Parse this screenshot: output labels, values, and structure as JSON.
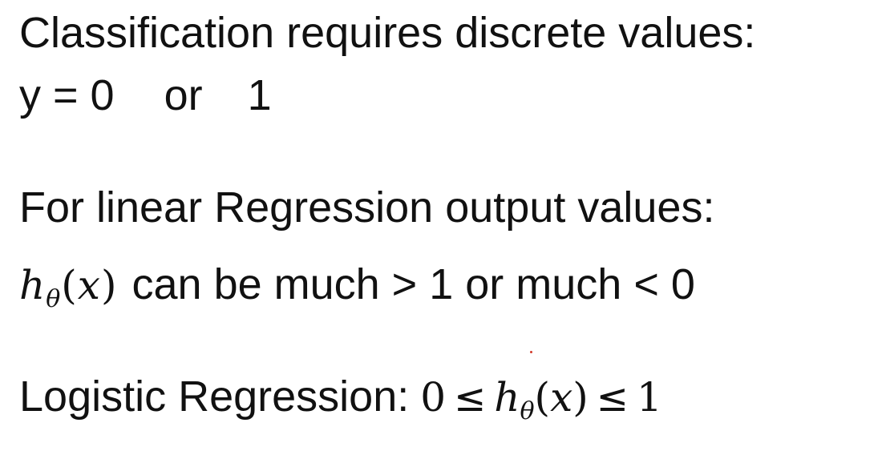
{
  "slide": {
    "line1": "Classification requires discrete values:",
    "line2": {
      "y_eq": "y = 0",
      "or": "or",
      "one": "1"
    },
    "line3": "For linear Regression output values:",
    "line4": {
      "h": "h",
      "theta": "θ",
      "arg_open": "(",
      "x": "x",
      "arg_close": ")",
      "text": "can be much > 1 or much < 0"
    },
    "line5": {
      "label": "Logistic Regression:",
      "zero": "0",
      "leq1": "≤",
      "h": "h",
      "theta": "θ",
      "arg_open": "(",
      "x": "x",
      "arg_close": ")",
      "leq2": "≤",
      "one": "1"
    },
    "colors": {
      "text": "#111111",
      "background": "#ffffff",
      "pointer_dot": "#d23a2a"
    }
  }
}
